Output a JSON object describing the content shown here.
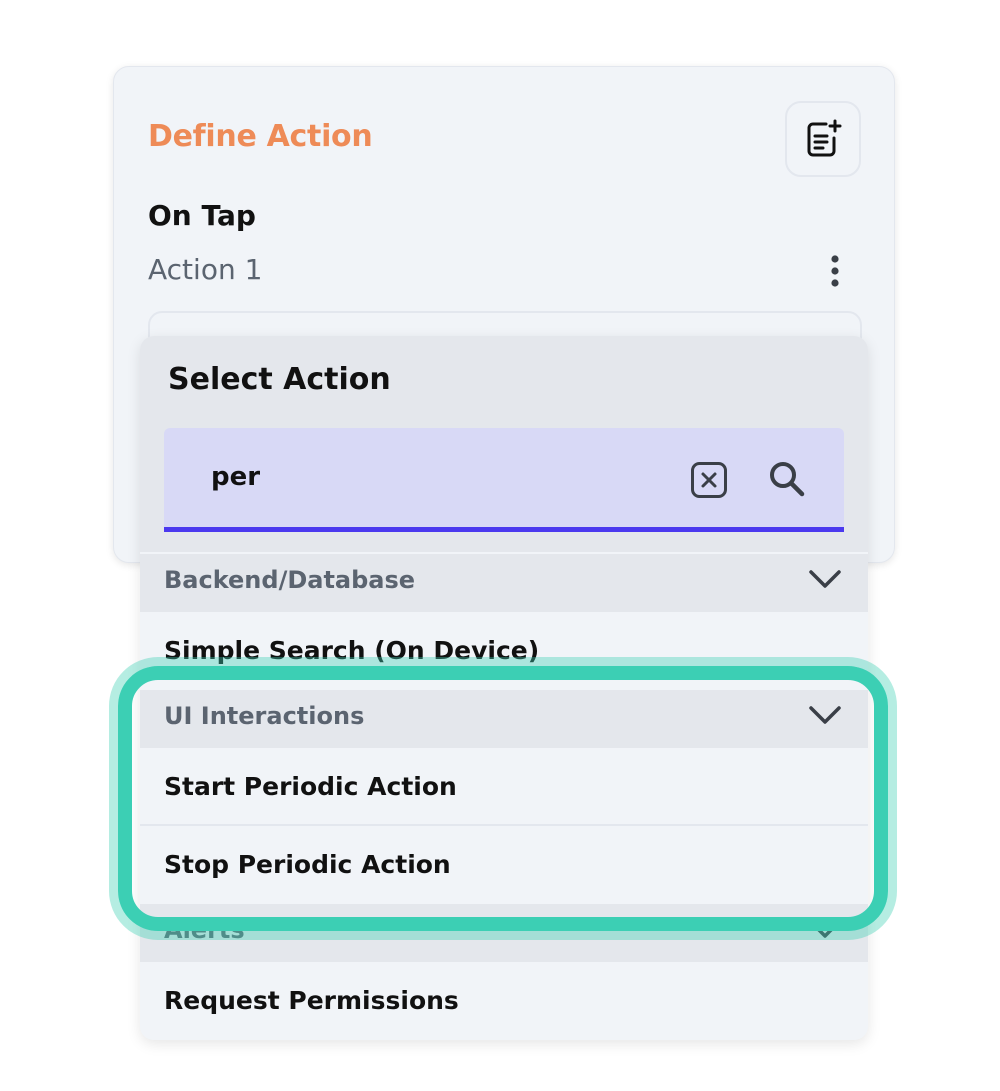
{
  "define_action": {
    "title": "Define Action",
    "trigger": "On Tap",
    "action_name": "Action 1"
  },
  "select_action": {
    "title": "Select Action",
    "search": {
      "value": "per"
    },
    "sections": [
      {
        "label": "Backend/Database",
        "items": [
          "Simple Search (On Device)"
        ]
      },
      {
        "label": "UI Interactions",
        "items": [
          "Start Periodic Action",
          "Stop Periodic Action"
        ]
      },
      {
        "label": "Alerts",
        "items": [
          "Request Permissions"
        ]
      }
    ]
  },
  "colors": {
    "accent_title": "#ee8b57",
    "search_underline": "#4b39ef",
    "search_background": "#d8d9f6",
    "highlight": "#3ccfb4"
  },
  "icons": [
    "add-note-icon",
    "more-vertical-icon",
    "clear-icon",
    "search-icon",
    "chevron-down-icon"
  ]
}
